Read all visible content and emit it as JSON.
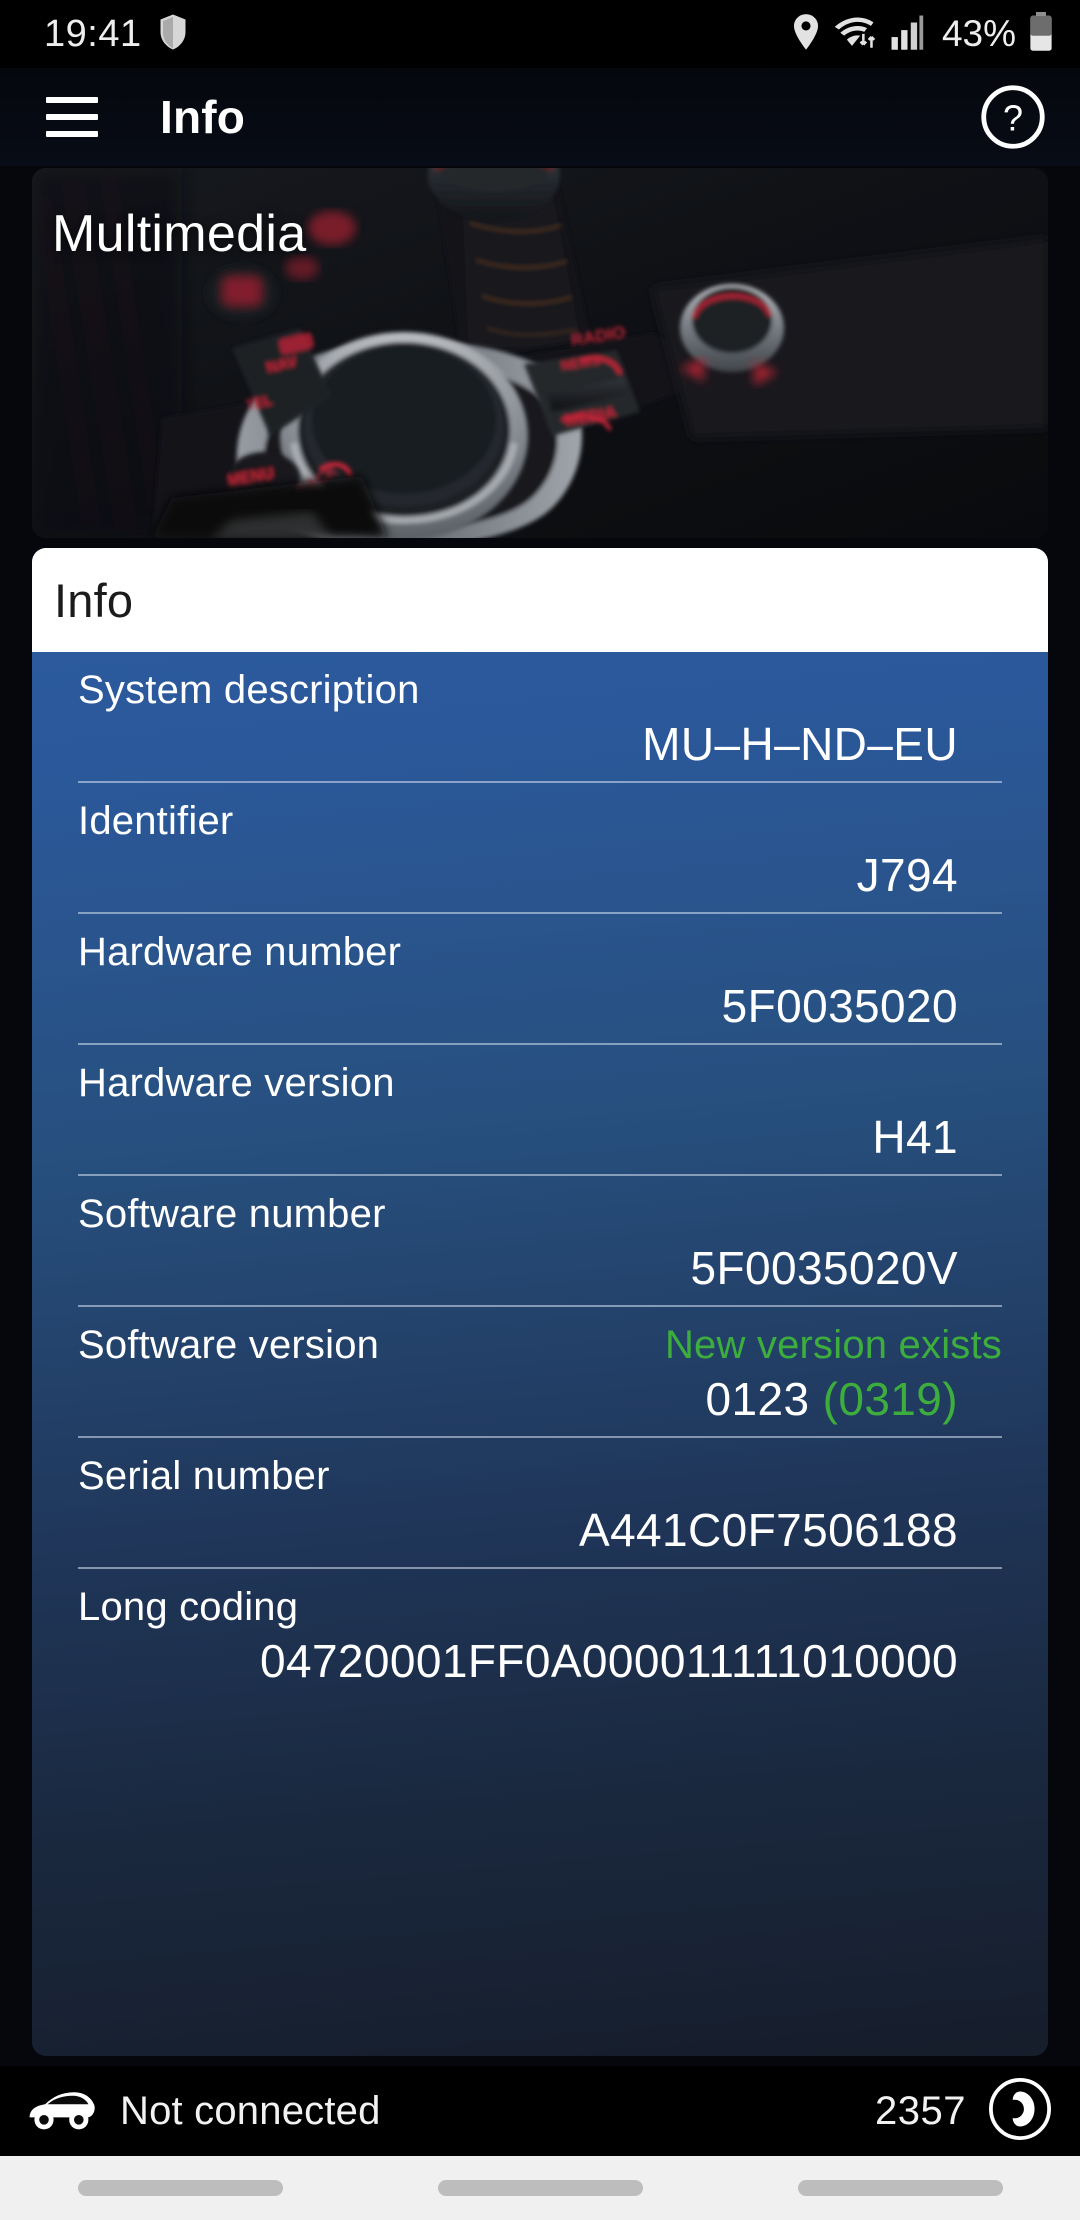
{
  "status_bar": {
    "time": "19:41",
    "battery_percent": "43%",
    "icons": [
      "shield-icon",
      "location-pin-icon",
      "wifi-icon",
      "cellular-signal-icon",
      "battery-icon"
    ]
  },
  "app_bar": {
    "menu_icon": "hamburger-menu-icon",
    "title": "Info",
    "help_icon": "help-circle-icon"
  },
  "hero": {
    "title": "Multimedia"
  },
  "panel": {
    "header_title": "Info",
    "rows": [
      {
        "label": "System description",
        "value": "MU–H–ND–EU",
        "note": "",
        "alt": ""
      },
      {
        "label": "Identifier",
        "value": "J794",
        "note": "",
        "alt": ""
      },
      {
        "label": "Hardware number",
        "value": "5F0035020",
        "note": "",
        "alt": ""
      },
      {
        "label": "Hardware version",
        "value": "H41",
        "note": "",
        "alt": ""
      },
      {
        "label": "Software number",
        "value": "5F0035020V",
        "note": "",
        "alt": ""
      },
      {
        "label": "Software version",
        "value": "0123",
        "note": "New version exists",
        "alt": "(0319)"
      },
      {
        "label": "Serial number",
        "value": "A441C0F7506188",
        "note": "",
        "alt": ""
      },
      {
        "label": "Long coding",
        "value": "04720001FF0A000011111010000",
        "note": "",
        "alt": ""
      }
    ]
  },
  "footer": {
    "car_icon": "car-icon",
    "connection_status": "Not connected",
    "count": "2357",
    "brand_icon": "obdeleven-logo-icon"
  },
  "nav_bar": {
    "buttons": [
      "recents-button",
      "home-button",
      "back-button"
    ]
  },
  "colors": {
    "accent_green": "#3dae3d",
    "panel_top": "#2c5ca0",
    "panel_bottom": "#161d2b",
    "white": "#ffffff"
  }
}
